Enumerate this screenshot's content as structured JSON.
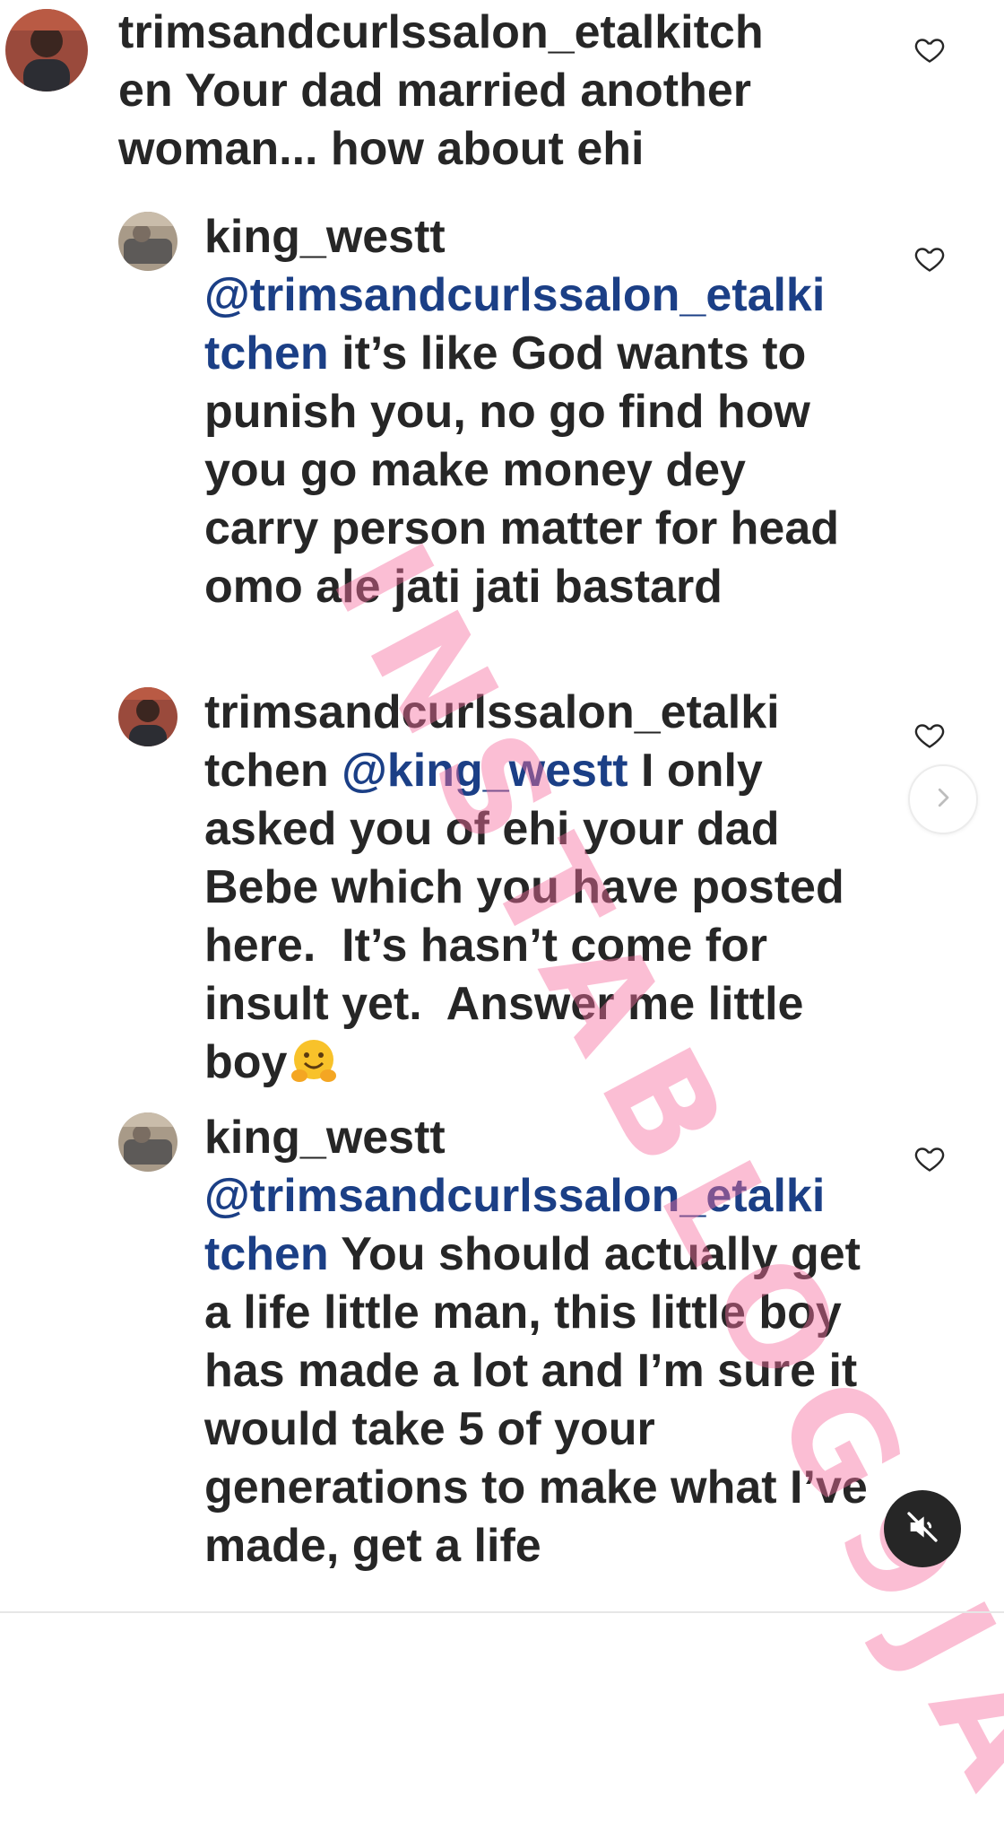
{
  "comments": [
    {
      "username": "trimsandcurlssalon_etalkitch\nen",
      "mention": "",
      "text": " Your dad married another woman... how about ehi",
      "like_icon": "heart-outline-icon"
    },
    {
      "username": "king_westt",
      "mention": "@trimsandcurlssalon_etalki\ntchen",
      "text": " it’s like God wants to punish you, no go find how you go make money dey carry person matter for head omo ale jati jati bastard",
      "like_icon": "heart-outline-icon"
    },
    {
      "username": "trimsandcurlssalon_etalki\ntchen",
      "mention": "@king_westt",
      "text": " I only asked you of ehi your dad Bebe which you have posted here.  It’s hasn’t come for insult yet.  Answer me little boy",
      "emoji": "hugging-face-emoji",
      "like_icon": "heart-outline-icon"
    },
    {
      "username": "king_westt",
      "mention": "@trimsandcurlssalon_etalki\ntchen",
      "text": " You should actually get a life little man, this little boy has made a lot and I’m sure it would take 5 of your generations to make what I’ve made, get a life",
      "like_icon": "heart-outline-icon"
    }
  ],
  "controls": {
    "next_icon": "chevron-right-icon",
    "mute_icon": "speaker-muted-icon"
  },
  "watermark": {
    "text": "INSTABLOG9JA"
  },
  "colors": {
    "text": "#262626",
    "mention": "#1b3f86",
    "watermark": "#f76ea0",
    "mute_button_bg": "#262626"
  }
}
